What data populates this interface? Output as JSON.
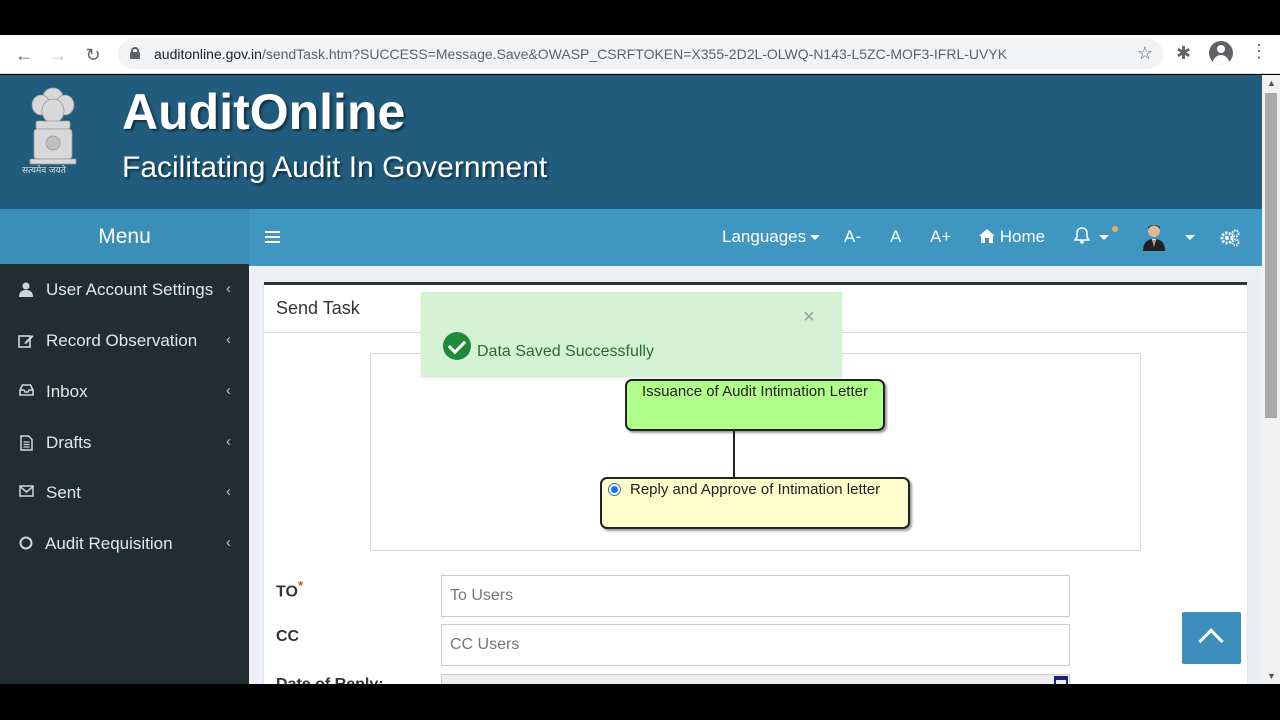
{
  "browser": {
    "url_host": "auditonline.gov.in",
    "url_path": "/sendTask.htm?SUCCESS=Message.Save&OWASP_CSRFTOKEN=X355-2D2L-OLWQ-N143-L5ZC-MOF3-IFRL-UVYK"
  },
  "banner": {
    "title": "AuditOnline",
    "subtitle": "Facilitating Audit In Government",
    "emblem_caption": "सत्यमेव जयते"
  },
  "menu": {
    "label": "Menu"
  },
  "topnav": {
    "languages": "Languages",
    "font_small": "A-",
    "font_normal": "A",
    "font_large": "A+",
    "home": "Home"
  },
  "sidebar": {
    "items": [
      {
        "label": "User Account Settings",
        "icon": "user-icon"
      },
      {
        "label": "Record Observation",
        "icon": "edit-icon"
      },
      {
        "label": "Inbox",
        "icon": "inbox-icon"
      },
      {
        "label": "Drafts",
        "icon": "file-icon"
      },
      {
        "label": "Sent",
        "icon": "envelope-icon"
      },
      {
        "label": "Audit Requisition",
        "icon": "circle-icon"
      }
    ]
  },
  "card": {
    "title": "Send Task"
  },
  "workflow": {
    "node1": "Issuance of Audit Intimation Letter",
    "node2": "Reply and Approve of Intimation letter"
  },
  "form": {
    "to_label": "TO",
    "to_required": "*",
    "to_placeholder": "To Users",
    "cc_label": "CC",
    "cc_placeholder": "CC Users",
    "date_label": "Date of Reply:"
  },
  "toast": {
    "message": "Data Saved Successfully",
    "close": "×"
  },
  "colors": {
    "banner": "#215c7d",
    "menubar": "#3b8eb6",
    "topnav": "#3f96c0",
    "sidebar": "#222d32",
    "toast_bg": "#d4f1d4",
    "node1": "#b0ff8a",
    "node2": "#ffffcc"
  }
}
